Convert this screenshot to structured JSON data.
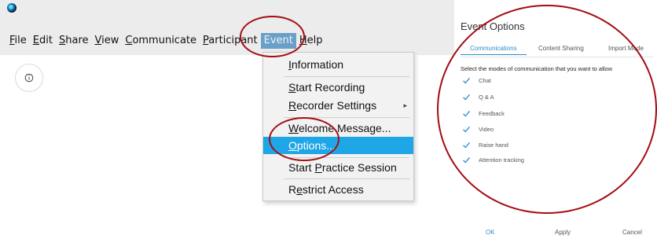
{
  "menubar": {
    "items": [
      {
        "label": "File",
        "key": "F",
        "rest": "ile"
      },
      {
        "label": "Edit",
        "key": "E",
        "rest": "dit"
      },
      {
        "label": "Share",
        "key": "S",
        "rest": "hare"
      },
      {
        "label": "View",
        "key": "V",
        "rest": "iew"
      },
      {
        "label": "Communicate",
        "key": "C",
        "rest": "ommunicate"
      },
      {
        "label": "Participant",
        "key": "P",
        "rest": "articipant"
      },
      {
        "label": "Event",
        "key": "",
        "rest": "Event"
      },
      {
        "label": "Help",
        "key": "H",
        "rest": "elp"
      }
    ]
  },
  "event_menu": {
    "items": [
      {
        "label": "Information",
        "pre": "",
        "key": "I",
        "post": "nformation"
      },
      {
        "label": "Start Recording",
        "pre": "",
        "key": "S",
        "post": "tart Recording"
      },
      {
        "label": "Recorder Settings",
        "pre": "",
        "key": "R",
        "post": "ecorder Settings",
        "has_submenu": true
      },
      {
        "label": "Welcome Message...",
        "pre": "",
        "key": "W",
        "post": "elcome Message..."
      },
      {
        "label": "Options...",
        "pre": "",
        "key": "O",
        "post": "ptions..."
      },
      {
        "label": "Start Practice Session",
        "pre": "Start ",
        "key": "P",
        "post": "ractice Session"
      },
      {
        "label": "Restrict Access",
        "pre": "R",
        "key": "e",
        "post": "strict Access"
      }
    ],
    "selected": "Options..."
  },
  "dialog": {
    "title": "Event Options",
    "tabs": [
      "Communications",
      "Content Sharing",
      "Import Mode"
    ],
    "active_tab": "Communications",
    "instruction": "Select the modes of communication that you want to allow",
    "options": [
      {
        "label": "Chat",
        "checked": true
      },
      {
        "label": "Q & A",
        "checked": true
      },
      {
        "label": "Feedback",
        "checked": true
      },
      {
        "label": "Video",
        "checked": true
      },
      {
        "label": "Raise hand",
        "checked": true
      },
      {
        "label": "Attention tracking",
        "checked": true
      }
    ],
    "buttons": {
      "ok": "OK",
      "apply": "Apply",
      "cancel": "Cancel"
    }
  },
  "colors": {
    "menu_highlight": "#1fa6e6",
    "event_active": "#6aa0c8",
    "annotation": "#a30d12",
    "accent": "#2f8ccd",
    "checkmark": "#2f8ccd"
  }
}
